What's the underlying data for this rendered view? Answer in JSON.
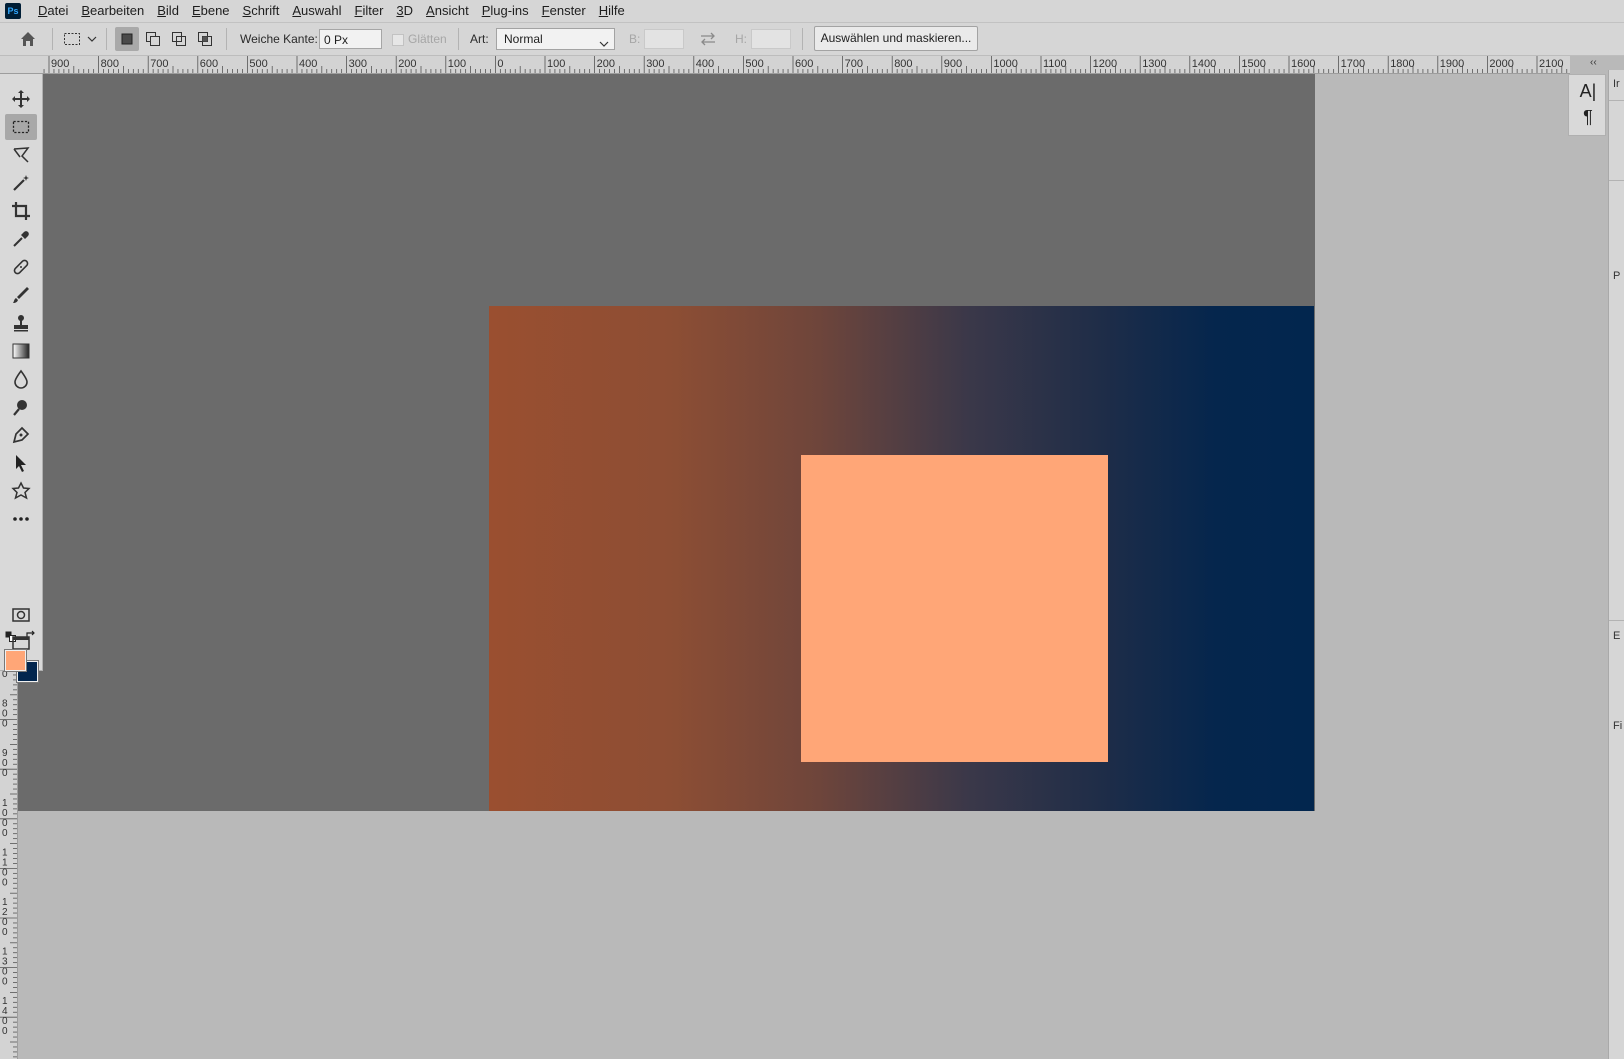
{
  "app": {
    "logo_text": "Ps"
  },
  "menu": [
    "Datei",
    "Bearbeiten",
    "Bild",
    "Ebene",
    "Schrift",
    "Auswahl",
    "Filter",
    "3D",
    "Ansicht",
    "Plug-ins",
    "Fenster",
    "Hilfe"
  ],
  "options": {
    "feather_label": "Weiche Kante:",
    "feather_value": "0 Px",
    "antialias_label": "Glätten",
    "style_label": "Art:",
    "style_value": "Normal",
    "width_label": "B:",
    "height_label": "H:",
    "mask_button": "Auswählen und maskieren..."
  },
  "ruler_top": [
    "900",
    "800",
    "700",
    "600",
    "500",
    "400",
    "300",
    "200",
    "100",
    "0",
    "100",
    "200",
    "300",
    "400",
    "500",
    "600",
    "700",
    "800",
    "900",
    "1000",
    "1100",
    "1200",
    "1300",
    "1400",
    "1500",
    "1600",
    "1700",
    "1800",
    "1900",
    "2000",
    "2100"
  ],
  "ruler_left": [
    "700",
    "800",
    "900",
    "1000",
    "1100",
    "1200",
    "1300",
    "1400"
  ],
  "colors": {
    "foreground": "#ffa677",
    "background": "#02264e",
    "gradient_start": "#9a4f30",
    "gradient_end": "#02264e",
    "pasteboard": "#6b6b6b",
    "workspace": "#b9b9b9"
  },
  "tools": [
    "move-tool",
    "rectangular-marquee-tool",
    "lasso-tool",
    "magic-wand-tool",
    "crop-tool",
    "eyedropper-tool",
    "healing-brush-tool",
    "brush-tool",
    "clone-stamp-tool",
    "gradient-tool",
    "blur-tool",
    "dodge-tool",
    "pen-tool",
    "path-selection-tool",
    "custom-shape-tool",
    "more-tools"
  ],
  "right_panel": {
    "rows": [
      "Ir",
      "P",
      "E",
      "Fi"
    ]
  }
}
